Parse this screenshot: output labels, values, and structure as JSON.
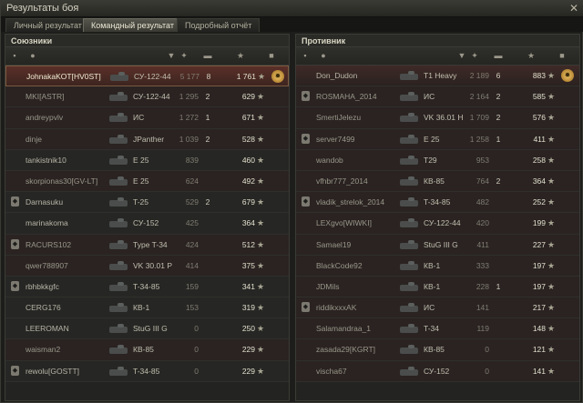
{
  "window": {
    "title": "Результаты боя",
    "close_icon": "close-icon"
  },
  "tabs": [
    {
      "label": "Личный результат",
      "active": false
    },
    {
      "label": "Командный результат",
      "active": true
    },
    {
      "label": "Подробный отчёт",
      "active": false
    }
  ],
  "allies": {
    "title": "Союзники",
    "rows": [
      {
        "name": "JohnakaKOT[HV0ST]",
        "vehicle": "СУ-122-44",
        "damage": "5 177",
        "frags": "8",
        "xp": "1 761",
        "medal": true,
        "highlight": "self",
        "platoon": false
      },
      {
        "name": "MKI[ASTR]",
        "vehicle": "СУ-122-44",
        "damage": "1 295",
        "frags": "2",
        "xp": "629",
        "dead": true
      },
      {
        "name": "andreypvlv",
        "vehicle": "ИС",
        "damage": "1 272",
        "frags": "1",
        "xp": "671",
        "dead": true
      },
      {
        "name": "dinje",
        "vehicle": "JPanther",
        "damage": "1 039",
        "frags": "2",
        "xp": "528",
        "dead": true
      },
      {
        "name": "tankistnik10",
        "vehicle": "E 25",
        "damage": "839",
        "frags": "",
        "xp": "460"
      },
      {
        "name": "skorpionas30[GV-LT]",
        "vehicle": "E 25",
        "damage": "624",
        "frags": "",
        "xp": "492",
        "dead": true
      },
      {
        "name": "Darnasuku",
        "vehicle": "T-25",
        "damage": "529",
        "frags": "2",
        "xp": "679",
        "platoon": true
      },
      {
        "name": "marinakoma",
        "vehicle": "СУ-152",
        "damage": "425",
        "frags": "",
        "xp": "364"
      },
      {
        "name": "RACURS102",
        "vehicle": "Type T-34",
        "damage": "424",
        "frags": "",
        "xp": "512",
        "platoon": true,
        "dead": true
      },
      {
        "name": "qwer788907",
        "vehicle": "VK 30.01 P",
        "damage": "414",
        "frags": "",
        "xp": "375",
        "dead": true
      },
      {
        "name": "rbhbkkgfc",
        "vehicle": "T-34-85",
        "damage": "159",
        "frags": "",
        "xp": "341",
        "platoon": true
      },
      {
        "name": "CERG176",
        "vehicle": "КВ-1",
        "damage": "153",
        "frags": "",
        "xp": "319"
      },
      {
        "name": "LEEROMAN",
        "vehicle": "StuG III G",
        "damage": "0",
        "frags": "",
        "xp": "250"
      },
      {
        "name": "waisman2",
        "vehicle": "КВ-85",
        "damage": "0",
        "frags": "",
        "xp": "229",
        "dead": true
      },
      {
        "name": "rewolu[GOSTT]",
        "vehicle": "T-34-85",
        "damage": "0",
        "frags": "",
        "xp": "229",
        "platoon": true
      }
    ]
  },
  "enemies": {
    "title": "Противник",
    "rows": [
      {
        "name": "Don_Dudon",
        "vehicle": "T1 Heavy",
        "damage": "2 189",
        "frags": "6",
        "xp": "883",
        "medal": true,
        "highlight": "top"
      },
      {
        "name": "ROSMAHA_2014",
        "vehicle": "ИС",
        "damage": "2 164",
        "frags": "2",
        "xp": "585",
        "platoon": true,
        "dead": true
      },
      {
        "name": "SmertiJelezu",
        "vehicle": "VK 36.01 H",
        "damage": "1 709",
        "frags": "2",
        "xp": "576",
        "dead": true
      },
      {
        "name": "server7499",
        "vehicle": "E 25",
        "damage": "1 258",
        "frags": "1",
        "xp": "411",
        "platoon": true,
        "dead": true
      },
      {
        "name": "wandob",
        "vehicle": "T29",
        "damage": "953",
        "frags": "",
        "xp": "258",
        "dead": true
      },
      {
        "name": "vfhbr777_2014",
        "vehicle": "КВ-85",
        "damage": "764",
        "frags": "2",
        "xp": "364",
        "dead": true
      },
      {
        "name": "vladik_strelok_2014",
        "vehicle": "T-34-85",
        "damage": "482",
        "frags": "",
        "xp": "252",
        "platoon": true,
        "dead": true
      },
      {
        "name": "LEXgvo[WIWKI]",
        "vehicle": "СУ-122-44",
        "damage": "420",
        "frags": "",
        "xp": "199",
        "dead": true
      },
      {
        "name": "Samael19",
        "vehicle": "StuG III G",
        "damage": "411",
        "frags": "",
        "xp": "227",
        "dead": true
      },
      {
        "name": "BlackCode92",
        "vehicle": "КВ-1",
        "damage": "333",
        "frags": "",
        "xp": "197",
        "dead": true
      },
      {
        "name": "JDMils",
        "vehicle": "КВ-1",
        "damage": "228",
        "frags": "1",
        "xp": "197",
        "dead": true
      },
      {
        "name": "riddikxxxAK",
        "vehicle": "ИС",
        "damage": "141",
        "frags": "",
        "xp": "217",
        "platoon": true,
        "dead": true
      },
      {
        "name": "Salamandraa_1",
        "vehicle": "T-34",
        "damage": "119",
        "frags": "",
        "xp": "148",
        "dead": true
      },
      {
        "name": "zasada29[KGRT]",
        "vehicle": "КВ-85",
        "damage": "0",
        "frags": "",
        "xp": "121",
        "dead": true
      },
      {
        "name": "vischa67",
        "vehicle": "СУ-152",
        "damage": "0",
        "frags": "",
        "xp": "141",
        "dead": true
      }
    ]
  }
}
